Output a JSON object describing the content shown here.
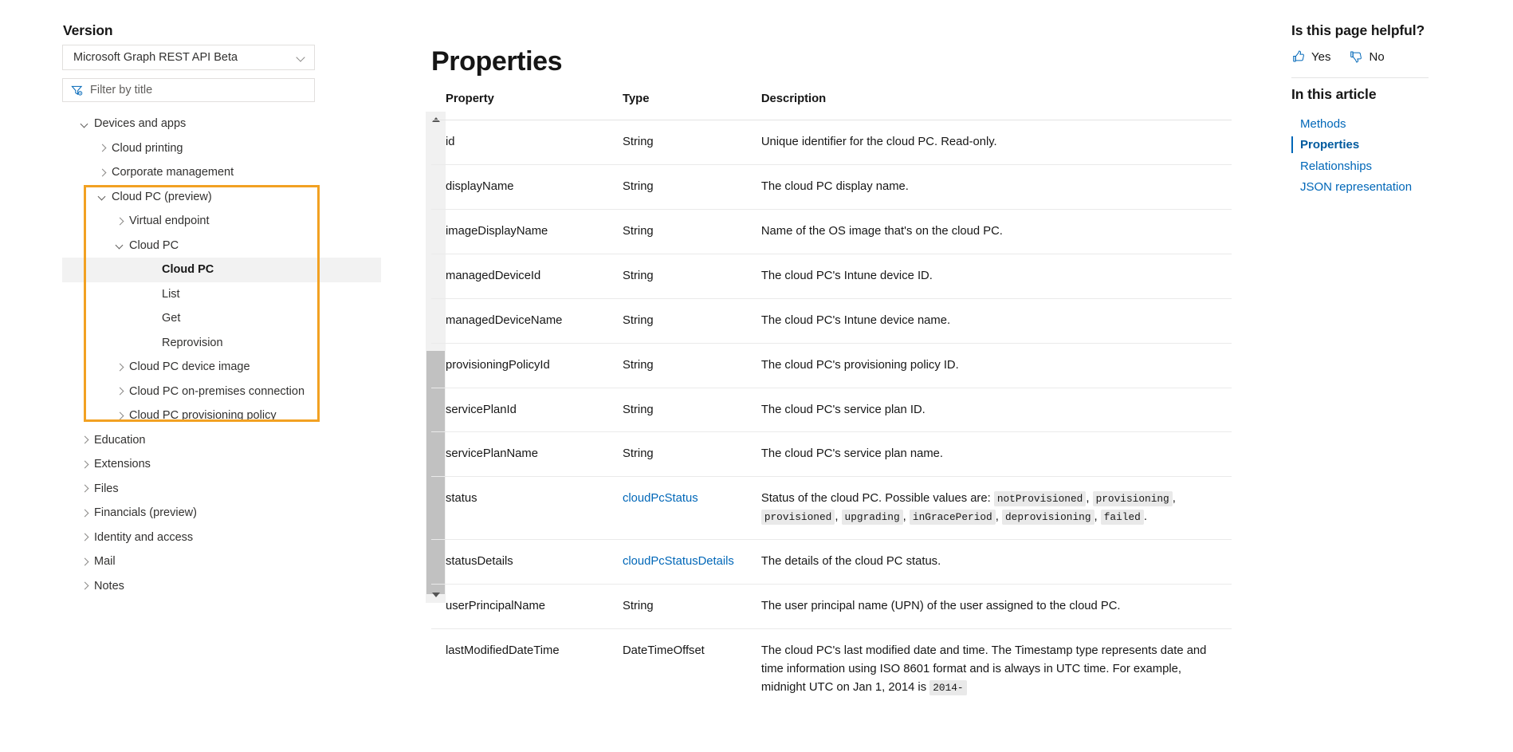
{
  "sidebar": {
    "version_label": "Version",
    "version_value": "Microsoft Graph REST API Beta",
    "filter_placeholder": "Filter by title",
    "tree": [
      {
        "label": "Devices and apps",
        "level": 0,
        "caret": "open",
        "selected": false
      },
      {
        "label": "Cloud printing",
        "level": 1,
        "caret": "closed",
        "selected": false
      },
      {
        "label": "Corporate management",
        "level": 1,
        "caret": "closed",
        "selected": false
      },
      {
        "label": "Cloud PC (preview)",
        "level": 1,
        "caret": "open",
        "selected": false
      },
      {
        "label": "Virtual endpoint",
        "level": 2,
        "caret": "closed",
        "selected": false
      },
      {
        "label": "Cloud PC",
        "level": 2,
        "caret": "open",
        "selected": false
      },
      {
        "label": "Cloud PC",
        "level": 3,
        "caret": "none",
        "selected": true
      },
      {
        "label": "List",
        "level": 3,
        "caret": "none",
        "selected": false
      },
      {
        "label": "Get",
        "level": 3,
        "caret": "none",
        "selected": false
      },
      {
        "label": "Reprovision",
        "level": 3,
        "caret": "none",
        "selected": false
      },
      {
        "label": "Cloud PC device image",
        "level": 2,
        "caret": "closed",
        "selected": false
      },
      {
        "label": "Cloud PC on-premises connection",
        "level": 2,
        "caret": "closed",
        "selected": false
      },
      {
        "label": "Cloud PC provisioning policy",
        "level": 2,
        "caret": "closed",
        "selected": false
      },
      {
        "label": "Education",
        "level": 0,
        "caret": "closed",
        "selected": false
      },
      {
        "label": "Extensions",
        "level": 0,
        "caret": "closed",
        "selected": false
      },
      {
        "label": "Files",
        "level": 0,
        "caret": "closed",
        "selected": false
      },
      {
        "label": "Financials (preview)",
        "level": 0,
        "caret": "closed",
        "selected": false
      },
      {
        "label": "Identity and access",
        "level": 0,
        "caret": "closed",
        "selected": false
      },
      {
        "label": "Mail",
        "level": 0,
        "caret": "closed",
        "selected": false
      },
      {
        "label": "Notes",
        "level": 0,
        "caret": "closed",
        "selected": false
      }
    ]
  },
  "main": {
    "title": "Properties",
    "columns": [
      "Property",
      "Type",
      "Description"
    ],
    "rows": [
      {
        "property": "id",
        "type": "String",
        "type_is_link": false,
        "desc_parts": [
          {
            "t": "text",
            "v": "Unique identifier for the cloud PC. Read-only."
          }
        ]
      },
      {
        "property": "displayName",
        "type": "String",
        "type_is_link": false,
        "desc_parts": [
          {
            "t": "text",
            "v": "The cloud PC display name."
          }
        ]
      },
      {
        "property": "imageDisplayName",
        "type": "String",
        "type_is_link": false,
        "desc_parts": [
          {
            "t": "text",
            "v": "Name of the OS image that's on the cloud PC."
          }
        ]
      },
      {
        "property": "managedDeviceId",
        "type": "String",
        "type_is_link": false,
        "desc_parts": [
          {
            "t": "text",
            "v": "The cloud PC's Intune device ID."
          }
        ]
      },
      {
        "property": "managedDeviceName",
        "type": "String",
        "type_is_link": false,
        "desc_parts": [
          {
            "t": "text",
            "v": "The cloud PC's Intune device name."
          }
        ]
      },
      {
        "property": "provisioningPolicyId",
        "type": "String",
        "type_is_link": false,
        "desc_parts": [
          {
            "t": "text",
            "v": "The cloud PC's provisioning policy ID."
          }
        ]
      },
      {
        "property": "servicePlanId",
        "type": "String",
        "type_is_link": false,
        "desc_parts": [
          {
            "t": "text",
            "v": "The cloud PC's service plan ID."
          }
        ]
      },
      {
        "property": "servicePlanName",
        "type": "String",
        "type_is_link": false,
        "desc_parts": [
          {
            "t": "text",
            "v": "The cloud PC's service plan name."
          }
        ]
      },
      {
        "property": "status",
        "type": "cloudPcStatus",
        "type_is_link": true,
        "desc_parts": [
          {
            "t": "text",
            "v": "Status of the cloud PC. Possible values are: "
          },
          {
            "t": "code",
            "v": "notProvisioned"
          },
          {
            "t": "text",
            "v": ", "
          },
          {
            "t": "code",
            "v": "provisioning"
          },
          {
            "t": "text",
            "v": ", "
          },
          {
            "t": "code",
            "v": "provisioned"
          },
          {
            "t": "text",
            "v": ", "
          },
          {
            "t": "code",
            "v": "upgrading"
          },
          {
            "t": "text",
            "v": ", "
          },
          {
            "t": "code",
            "v": "inGracePeriod"
          },
          {
            "t": "text",
            "v": ", "
          },
          {
            "t": "code",
            "v": "deprovisioning"
          },
          {
            "t": "text",
            "v": ", "
          },
          {
            "t": "code",
            "v": "failed"
          },
          {
            "t": "text",
            "v": "."
          }
        ]
      },
      {
        "property": "statusDetails",
        "type": "cloudPcStatusDetails",
        "type_is_link": true,
        "desc_parts": [
          {
            "t": "text",
            "v": "The details of the cloud PC status."
          }
        ]
      },
      {
        "property": "userPrincipalName",
        "type": "String",
        "type_is_link": false,
        "desc_parts": [
          {
            "t": "text",
            "v": "The user principal name (UPN) of the user assigned to the cloud PC."
          }
        ]
      },
      {
        "property": "lastModifiedDateTime",
        "type": "DateTimeOffset",
        "type_is_link": false,
        "desc_parts": [
          {
            "t": "text",
            "v": "The cloud PC's last modified date and time. The Timestamp type represents date and time information using ISO 8601 format and is always in UTC time. For example, midnight UTC on Jan 1, 2014 is "
          },
          {
            "t": "code",
            "v": "2014-"
          }
        ]
      }
    ]
  },
  "right_rail": {
    "helpful_title": "Is this page helpful?",
    "yes_label": "Yes",
    "no_label": "No",
    "article_title": "In this article",
    "toc": [
      {
        "label": "Methods",
        "active": false
      },
      {
        "label": "Properties",
        "active": true
      },
      {
        "label": "Relationships",
        "active": false
      },
      {
        "label": "JSON representation",
        "active": false
      }
    ]
  },
  "colors": {
    "accent_link": "#0067b8",
    "highlight_box": "#f2a122",
    "selected_row_bg": "#f2f2f2",
    "code_bg": "#e9e9e9"
  }
}
